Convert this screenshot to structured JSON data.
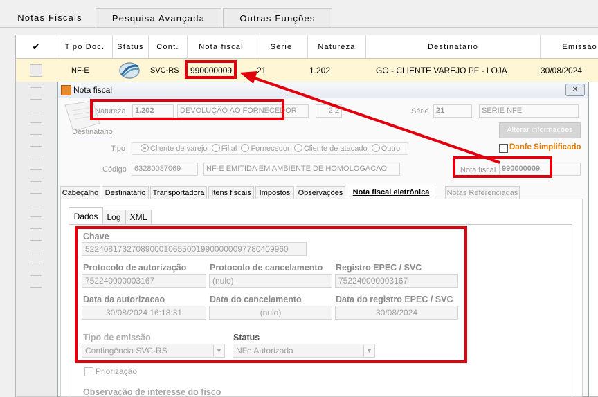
{
  "tabs": {
    "notas_fiscais": "Notas Fiscais",
    "pesquisa_avancada": "Pesquisa Avançada",
    "outras_funcoes": "Outras Funções"
  },
  "grid": {
    "check_header": "✔",
    "headers": {
      "tipo_doc": "Tipo Doc.",
      "status": "Status",
      "cont": "Cont.",
      "nota_fiscal": "Nota fiscal",
      "serie": "Série",
      "natureza": "Natureza",
      "destinatario": "Destinatário",
      "emissao": "Emissão"
    },
    "row": {
      "tipo_doc": "NF-E",
      "cont": "SVC-RS",
      "nota_fiscal": "990000009",
      "serie": "21",
      "natureza": "1.202",
      "destinatario": "GO - CLIENTE VAREJO PF - LOJA",
      "emissao": "30/08/2024"
    }
  },
  "dialog": {
    "title": "Nota fiscal",
    "close_glyph": "✕",
    "natureza_label": "Natureza",
    "natureza_code": "1.202",
    "natureza_desc": "DEVOLUÇÃO AO FORNECEDOR",
    "natureza_extra": "2.2",
    "serie_label": "Série",
    "serie_value": "21",
    "serie_desc": "SERIE NFE",
    "alterar_button": "Alterar informações",
    "danfe_label": "Danfe Simplificado",
    "destinatario_label": "Destinatário",
    "tipo_label": "Tipo",
    "tipo_options": [
      "Cliente de varejo",
      "Filial",
      "Fornecedor",
      "Cliente de atacado",
      "Outro"
    ],
    "codigo_label": "Código",
    "codigo_value": "63280037069",
    "codigo_desc": "NF-E EMITIDA EM AMBIENTE DE HOMOLOGACAO",
    "nota_fiscal_label": "Nota fiscal",
    "nota_fiscal_value": "990000009",
    "tabs": [
      "Cabeçalho",
      "Destinatário",
      "Transportadora",
      "Itens fiscais",
      "Impostos",
      "Observações",
      "Nota fiscal eletrônica",
      "Notas Referenciadas"
    ],
    "subtabs": [
      "Dados",
      "Log",
      "XML"
    ],
    "dados": {
      "chave_label": "Chave",
      "chave_value": "52240817327089000106550019900000097780409960",
      "prot_aut_label": "Protocolo de autorização",
      "prot_aut_value": "752240000003167",
      "prot_canc_label": "Protocolo de cancelamento",
      "prot_canc_value": "(nulo)",
      "reg_epec_label": "Registro EPEC / SVC",
      "reg_epec_value": "752240000003167",
      "data_aut_label": "Data da autorizacao",
      "data_aut_value": "30/08/2024 16:18:31",
      "data_canc_label": "Data do cancelamento",
      "data_canc_value": "(nulo)",
      "data_reg_label": "Data do registro EPEC / SVC",
      "data_reg_value": "30/08/2024",
      "tipo_emissao_label": "Tipo de emissão",
      "tipo_emissao_value": "Contingência SVC-RS",
      "status_label": "Status",
      "status_value": "NFe Autorizada",
      "priorizacao_label": "Priorização",
      "obs_label": "Observação de interesse do fisco"
    }
  },
  "colors": {
    "highlight": "#e0000e",
    "row_bg": "#fff6d6",
    "danfe": "#e07800"
  }
}
